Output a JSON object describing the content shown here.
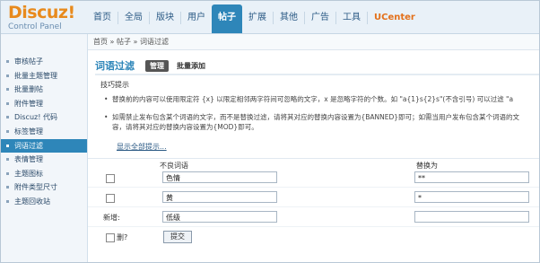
{
  "app": {
    "logo_title": "Discuz!",
    "logo_subtitle": "Control Panel"
  },
  "nav": {
    "tabs": [
      "首页",
      "全局",
      "版块",
      "用户",
      "帖子",
      "扩展",
      "其他",
      "广告",
      "工具",
      "UCenter"
    ],
    "active": "帖子"
  },
  "sidebar": {
    "items": [
      "审核帖子",
      "批量主题管理",
      "批量删帖",
      "附件管理",
      "Discuz! 代码",
      "标签管理",
      "词语过滤",
      "表情管理",
      "主题图标",
      "附件类型尺寸",
      "主题回收站"
    ],
    "active": "词语过滤"
  },
  "breadcrumb": "首页 » 帖子 » 词语过滤",
  "header": {
    "title": "词语过滤",
    "btn_manage": "管理",
    "btn_batch_add": "批量添加"
  },
  "tips": {
    "title": "技巧提示",
    "tip1": "替换前的内容可以使用限定符 {x} 以限定相邻两字符间可忽略的文字，x 是忽略字符的个数。如 \"a{1}s{2}s\"(不含引号) 可以过滤 \"a",
    "tip2_line1": "如需禁止发布包含某个词语的文字，而不是替换过滤，请将其对应的替换内容设置为{BANNED}即可；如需当用户发布包含某个词语的文",
    "tip2_line2": "容，请将其对应的替换内容设置为{MOD}即可。",
    "show_all": "显示全部提示..."
  },
  "table": {
    "col_bad": "不良词语",
    "col_replace": "替换为",
    "rows": [
      {
        "bad": "色情",
        "replace": "**"
      },
      {
        "bad": "黄",
        "replace": "*"
      }
    ],
    "new_label": "新增:",
    "new_bad": "低级",
    "new_replace": "",
    "delete_label": "删?",
    "submit": "提交"
  }
}
